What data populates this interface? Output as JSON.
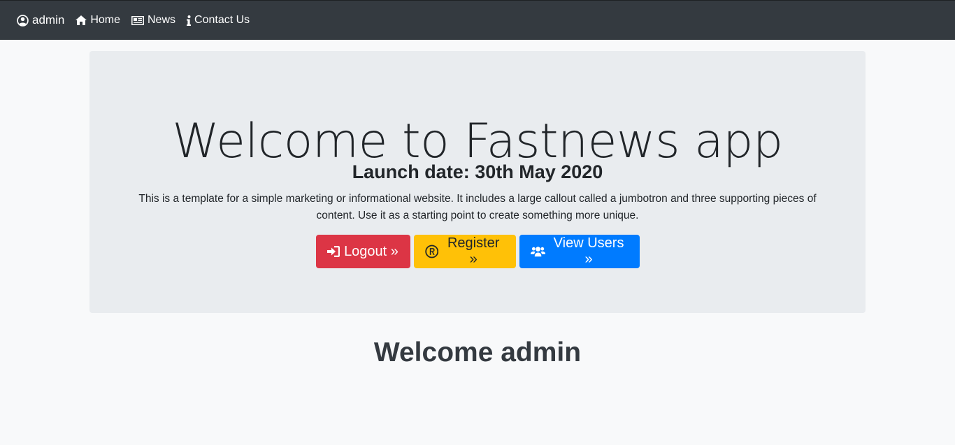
{
  "navbar": {
    "brand_label": "admin",
    "brand_icon": "user-circle-icon",
    "items": [
      {
        "label": "Home",
        "icon": "home-icon"
      },
      {
        "label": "News",
        "icon": "newspaper-icon"
      },
      {
        "label": "Contact Us",
        "icon": "info-icon"
      }
    ]
  },
  "jumbotron": {
    "title": "Welcome to Fastnews app",
    "subtitle": "Launch date: 30th May 2020",
    "lead": "This is a template for a simple marketing or informational website. It includes a large callout called a jumbotron and three supporting pieces of content. Use it as a starting point to create something more unique.",
    "buttons": [
      {
        "label": "Logout »",
        "icon": "sign-in-icon",
        "color": "#dc3545"
      },
      {
        "label": "Register »",
        "icon": "registered-icon",
        "color": "#ffc107"
      },
      {
        "label": "View Users »",
        "icon": "users-icon",
        "color": "#007bff"
      }
    ]
  },
  "welcome_text": "Welcome admin",
  "colors": {
    "navbar_bg": "#343a40",
    "jumbotron_bg": "#e9ecef",
    "page_bg": "#f8f9fa"
  }
}
